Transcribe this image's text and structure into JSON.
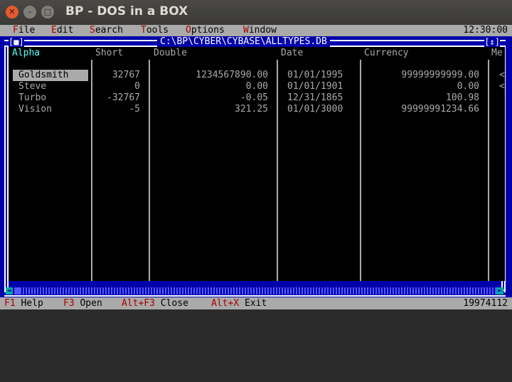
{
  "window": {
    "title": "BP - DOS in a BOX"
  },
  "menu": {
    "items": [
      {
        "hot": "F",
        "rest": "ile"
      },
      {
        "hot": "E",
        "rest": "dit"
      },
      {
        "hot": "S",
        "rest": "earch"
      },
      {
        "hot": "T",
        "rest": "ools"
      },
      {
        "hot": "O",
        "rest": "ptions"
      },
      {
        "hot": "W",
        "rest": "indow"
      }
    ],
    "clock": "12:30:00"
  },
  "frame": {
    "close_box": "[■]",
    "path": "C:\\BP\\CYBER\\CYBASE\\ALLTYPES.DB",
    "zoom_box": "[↕]"
  },
  "table": {
    "headers": [
      "Alpha",
      "Short",
      "Double",
      "Date",
      "Currency",
      "Me"
    ],
    "rows": [
      {
        "alpha": "Goldsmith",
        "short": "32767",
        "double": "1234567890.00",
        "date": "01/01/1995",
        "currency": "99999999999.00",
        "memo": "<"
      },
      {
        "alpha": "Steve",
        "short": "0",
        "double": "0.00",
        "date": "01/01/1901",
        "currency": "0.00",
        "memo": "<"
      },
      {
        "alpha": "Turbo",
        "short": "-32767",
        "double": "-0.05",
        "date": "12/31/1865",
        "currency": "100.98",
        "memo": ""
      },
      {
        "alpha": "Vision",
        "short": "-5",
        "double": "321.25",
        "date": "01/01/3000",
        "currency": "99999991234.66",
        "memo": ""
      }
    ],
    "selected_row": 0
  },
  "scrollbar": {
    "left_arrow": "◄",
    "right_arrow": "►"
  },
  "status": {
    "items": [
      {
        "key": "F1",
        "label": "Help"
      },
      {
        "key": "F3",
        "label": "Open"
      },
      {
        "key": "Alt+F3",
        "label": "Close"
      },
      {
        "key": "Alt+X",
        "label": "Exit"
      }
    ],
    "memory": "19974112"
  },
  "colors": {
    "dos_blue": "#0000aa",
    "gray": "#aaaaaa",
    "hotkey_red": "#aa0000",
    "cyan": "#55ffff"
  }
}
